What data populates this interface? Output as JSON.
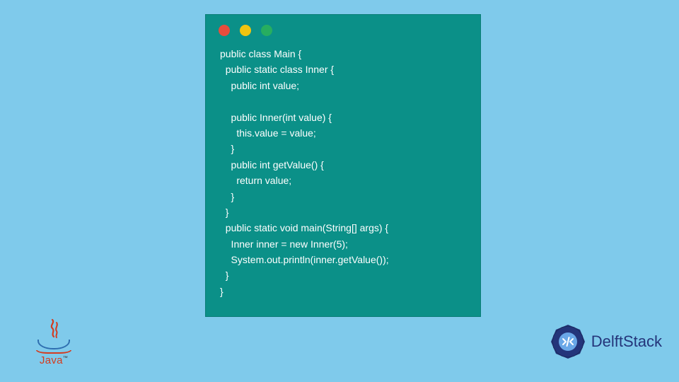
{
  "code": {
    "lines": [
      "public class Main {",
      "  public static class Inner {",
      "    public int value;",
      "",
      "    public Inner(int value) {",
      "      this.value = value;",
      "    }",
      "    public int getValue() {",
      "      return value;",
      "    }",
      "  }",
      "  public static void main(String[] args) {",
      "    Inner inner = new Inner(5);",
      "    System.out.println(inner.getValue());",
      "  }",
      "}"
    ]
  },
  "logos": {
    "java_label": "Java",
    "java_tm": "™",
    "delft_name": "Delft",
    "delft_stack": "Stack"
  },
  "colors": {
    "background": "#7fcaeb",
    "window_bg": "#0b9088",
    "dot_red": "#e74c3c",
    "dot_yellow": "#f1c40f",
    "dot_green": "#27ae60",
    "code_text": "#ffffff",
    "delft_color": "#24357a",
    "java_red": "#d43b1f",
    "java_blue": "#2f6fb0"
  }
}
